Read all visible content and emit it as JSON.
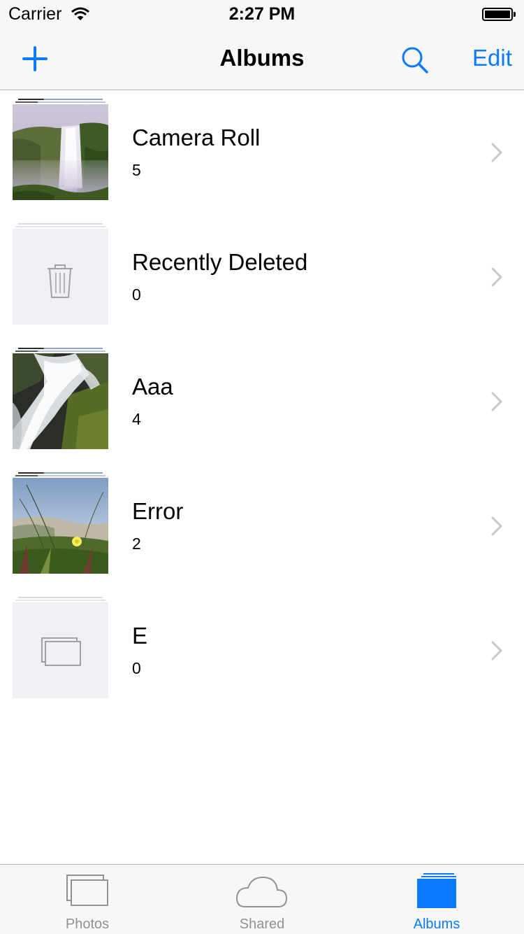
{
  "status_bar": {
    "carrier": "Carrier",
    "time": "2:27 PM"
  },
  "nav": {
    "title": "Albums",
    "edit_label": "Edit"
  },
  "albums": [
    {
      "title": "Camera Roll",
      "count": "5",
      "thumbnail": "waterfall-photo"
    },
    {
      "title": "Recently Deleted",
      "count": "0",
      "thumbnail": "trash-icon"
    },
    {
      "title": "Aaa",
      "count": "4",
      "thumbnail": "cascade-photo"
    },
    {
      "title": "Error",
      "count": "2",
      "thumbnail": "flower-photo"
    },
    {
      "title": "E",
      "count": "0",
      "thumbnail": "album-placeholder-icon"
    }
  ],
  "tabs": [
    {
      "label": "Photos",
      "icon": "photos-icon",
      "active": false
    },
    {
      "label": "Shared",
      "icon": "cloud-icon",
      "active": false
    },
    {
      "label": "Albums",
      "icon": "albums-icon",
      "active": true
    }
  ],
  "colors": {
    "accent": "#0a7aff",
    "inactive": "#929292",
    "bar_background": "#f7f7f7"
  }
}
